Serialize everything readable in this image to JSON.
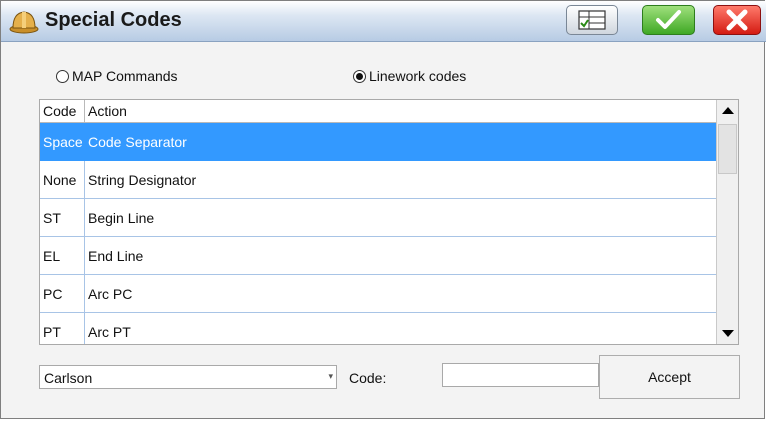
{
  "window": {
    "title": "Special Codes"
  },
  "icons": {
    "app": "hardhat-icon",
    "list": "list-view-icon",
    "ok": "check-icon",
    "close": "close-icon"
  },
  "colors": {
    "selection": "#3399ff",
    "ok_green": "#3fa824",
    "close_red": "#d41b12"
  },
  "mode": {
    "options": [
      {
        "label": "MAP Commands",
        "selected": false
      },
      {
        "label": "Linework codes",
        "selected": true
      }
    ]
  },
  "table": {
    "columns": [
      "Code",
      "Action"
    ],
    "rows": [
      {
        "code": "Space",
        "action": "Code Separator",
        "selected": true
      },
      {
        "code": "None",
        "action": "String Designator",
        "selected": false
      },
      {
        "code": "ST",
        "action": "Begin Line",
        "selected": false
      },
      {
        "code": "EL",
        "action": "End Line",
        "selected": false
      },
      {
        "code": "PC",
        "action": "Arc PC",
        "selected": false
      },
      {
        "code": "PT",
        "action": "Arc PT",
        "selected": false
      }
    ]
  },
  "footer": {
    "library_value": "Carlson",
    "code_label": "Code:",
    "code_value": "",
    "accept_label": "Accept"
  }
}
